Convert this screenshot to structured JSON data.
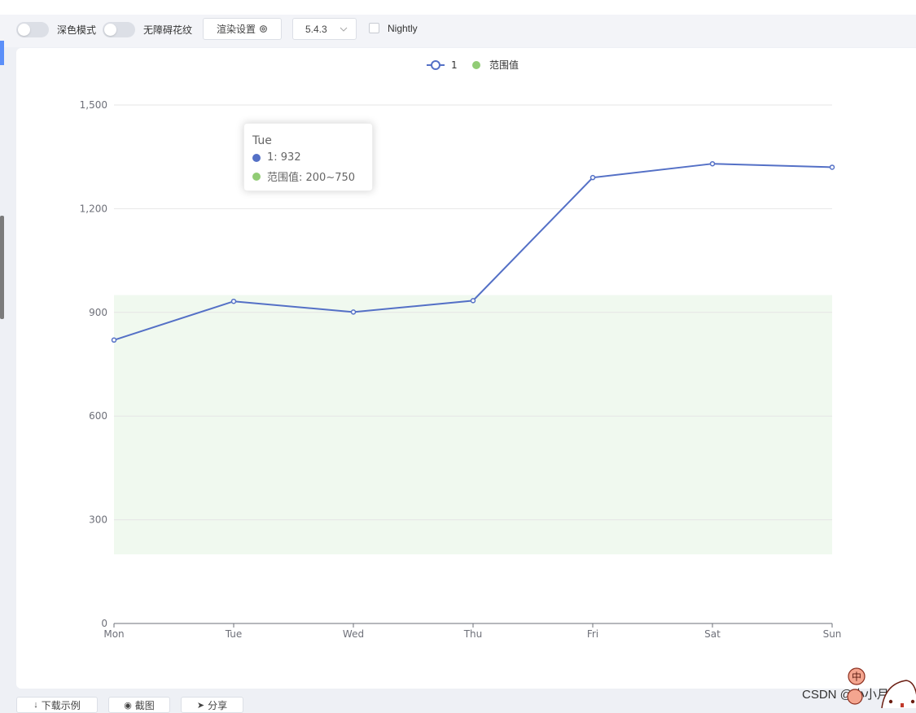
{
  "toolbar": {
    "dark_mode_label": "深色模式",
    "accessibility_label": "无障碍花纹",
    "render_settings_label": "渲染设置",
    "version_value": "5.4.3",
    "nightly_label": "Nightly"
  },
  "bottom": {
    "download_label": "下载示例",
    "screenshot_label": "截图",
    "share_label": "分享",
    "watermark": "CSDN @小小月亮",
    "mascot_badge": "中"
  },
  "colors": {
    "line": "#5470c6",
    "range_legend": "#91cc75",
    "range_fill": "#f0f9ef",
    "axis": "#6e7079",
    "grid": "#e6e6e6"
  },
  "chart_data": {
    "type": "line",
    "categories": [
      "Mon",
      "Tue",
      "Wed",
      "Thu",
      "Fri",
      "Sat",
      "Sun"
    ],
    "series": [
      {
        "name": "1",
        "values": [
          820,
          932,
          901,
          934,
          1290,
          1330,
          1320
        ]
      }
    ],
    "range_band": {
      "name": "范围值",
      "from": 200,
      "to": 950
    },
    "ylim": [
      0,
      1500
    ],
    "yticks": [
      0,
      300,
      600,
      900,
      1200,
      1500
    ],
    "ytick_labels": [
      "0",
      "300",
      "600",
      "900",
      "1,200",
      "1,500"
    ],
    "grid": true,
    "legend_position": "top-center",
    "tooltip": {
      "title": "Tue",
      "series_line": "1:  932",
      "range_line": "范围值:  200~750"
    }
  }
}
